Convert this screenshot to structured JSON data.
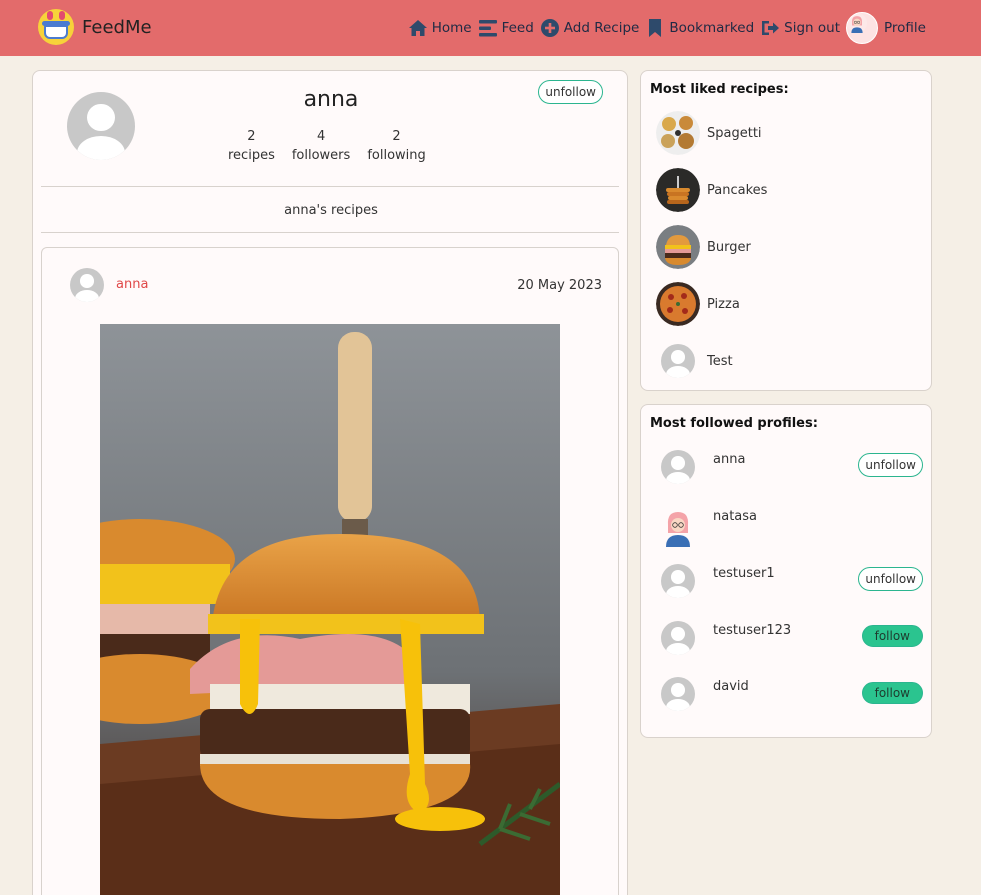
{
  "nav": {
    "brand": "FeedMe",
    "links": [
      {
        "label": "Home",
        "icon": "home-icon"
      },
      {
        "label": "Feed",
        "icon": "bars-icon"
      },
      {
        "label": "Add Recipe",
        "icon": "plus-circle-icon"
      },
      {
        "label": "Bookmarked",
        "icon": "bookmark-icon"
      },
      {
        "label": "Sign out",
        "icon": "sign-out-icon"
      },
      {
        "label": "Profile",
        "icon": "avatar"
      }
    ]
  },
  "profile": {
    "name": "anna",
    "stats": [
      {
        "count": "2",
        "label": "recipes"
      },
      {
        "count": "4",
        "label": "followers"
      },
      {
        "count": "2",
        "label": "following"
      }
    ],
    "action": "unfollow",
    "section_label": "anna's recipes"
  },
  "post": {
    "author": "anna",
    "date": "20 May 2023"
  },
  "liked": {
    "title": "Most liked recipes:",
    "items": [
      {
        "name": "Spagetti"
      },
      {
        "name": "Pancakes"
      },
      {
        "name": "Burger"
      },
      {
        "name": "Pizza"
      },
      {
        "name": "Test"
      }
    ]
  },
  "followed": {
    "title": "Most followed profiles:",
    "items": [
      {
        "name": "anna",
        "action": "unfollow"
      },
      {
        "name": "natasa",
        "action": ""
      },
      {
        "name": "testuser1",
        "action": "unfollow"
      },
      {
        "name": "testuser123",
        "action": "follow"
      },
      {
        "name": "david",
        "action": "follow"
      }
    ]
  },
  "colors": {
    "navbar": "#e36b6b",
    "background": "#f5efe6",
    "accent_green": "#2bc48f",
    "author_red": "#e04848"
  }
}
